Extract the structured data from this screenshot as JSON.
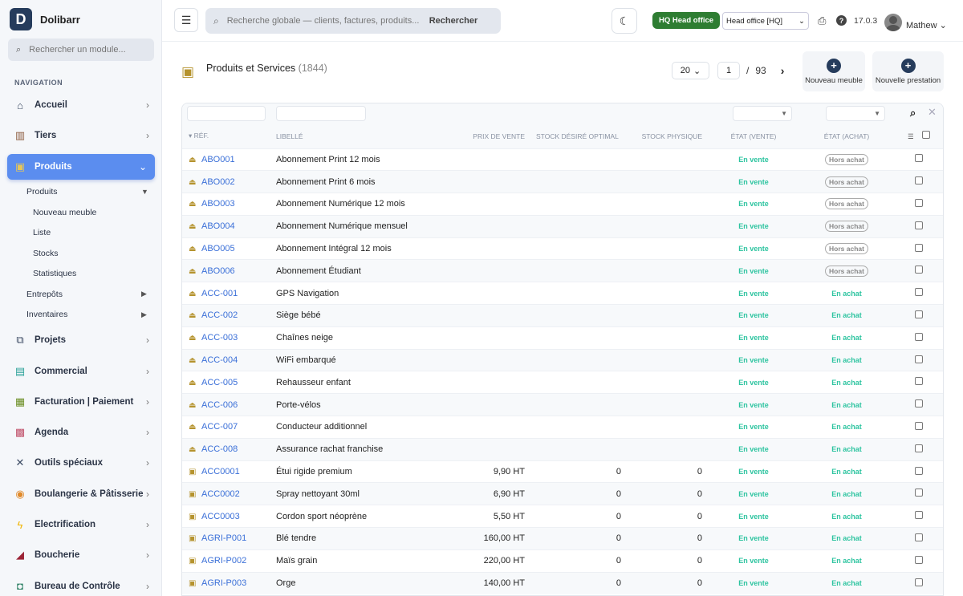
{
  "app": {
    "name": "Dolibarr",
    "logo_letter": "D"
  },
  "sidebar": {
    "search_placeholder": "Rechercher un module...",
    "heading": "NAVIGATION",
    "items": [
      {
        "label": "Accueil",
        "icon": "home-icon"
      },
      {
        "label": "Tiers",
        "icon": "building-icon"
      },
      {
        "label": "Produits",
        "icon": "box-icon",
        "active": true
      },
      {
        "label": "Projets",
        "icon": "sitemap-icon"
      },
      {
        "label": "Commercial",
        "icon": "briefcase-icon"
      },
      {
        "label": "Facturation | Paiement",
        "icon": "invoice-icon"
      },
      {
        "label": "Agenda",
        "icon": "calendar-icon"
      },
      {
        "label": "Outils spéciaux",
        "icon": "tools-icon"
      },
      {
        "label": "Boulangerie & Pâtisserie",
        "icon": "bread-icon"
      },
      {
        "label": "Electrification",
        "icon": "bolt-icon"
      },
      {
        "label": "Boucherie",
        "icon": "meat-icon"
      },
      {
        "label": "Bureau de Contrôle",
        "icon": "shield-icon"
      }
    ],
    "produits_sub": {
      "produits": "Produits",
      "nouveau_meuble": "Nouveau meuble",
      "liste": "Liste",
      "stocks": "Stocks",
      "statistiques": "Statistiques",
      "entrepots": "Entrepôts",
      "inventaires": "Inventaires"
    }
  },
  "topbar": {
    "search_placeholder": "Recherche globale — clients, factures, produits...",
    "search_button": "Rechercher",
    "entity_badge": "HQ Head office",
    "entity_select": "Head office [HQ]",
    "version": "17.0.3",
    "username": "Mathew"
  },
  "page": {
    "title": "Produits et Services",
    "count": "(1844)",
    "limit": "20",
    "current_page": "1",
    "slash": "/",
    "total_pages": "93",
    "actions": {
      "new_furniture": "Nouveau meuble",
      "new_service": "Nouvelle prestation"
    }
  },
  "table": {
    "headers": {
      "ref": "Réf.",
      "label": "Libellé",
      "price": "Prix de vente",
      "stock_desired": "Stock désiré optimal",
      "stock_physical": "Stock physique",
      "state_sale": "État (Vente)",
      "state_purchase": "État (Achat)"
    },
    "rows": [
      {
        "ref": "ABO001",
        "label": "Abonnement Print 12 mois",
        "price": "",
        "stock_desired": "",
        "stock": "",
        "sale": "En vente",
        "purchase": "Hors achat",
        "type": "service"
      },
      {
        "ref": "ABO002",
        "label": "Abonnement Print 6 mois",
        "price": "",
        "stock_desired": "",
        "stock": "",
        "sale": "En vente",
        "purchase": "Hors achat",
        "type": "service"
      },
      {
        "ref": "ABO003",
        "label": "Abonnement Numérique 12 mois",
        "price": "",
        "stock_desired": "",
        "stock": "",
        "sale": "En vente",
        "purchase": "Hors achat",
        "type": "service"
      },
      {
        "ref": "ABO004",
        "label": "Abonnement Numérique mensuel",
        "price": "",
        "stock_desired": "",
        "stock": "",
        "sale": "En vente",
        "purchase": "Hors achat",
        "type": "service"
      },
      {
        "ref": "ABO005",
        "label": "Abonnement Intégral 12 mois",
        "price": "",
        "stock_desired": "",
        "stock": "",
        "sale": "En vente",
        "purchase": "Hors achat",
        "type": "service"
      },
      {
        "ref": "ABO006",
        "label": "Abonnement Étudiant",
        "price": "",
        "stock_desired": "",
        "stock": "",
        "sale": "En vente",
        "purchase": "Hors achat",
        "type": "service"
      },
      {
        "ref": "ACC-001",
        "label": "GPS Navigation",
        "price": "",
        "stock_desired": "",
        "stock": "",
        "sale": "En vente",
        "purchase": "En achat",
        "type": "service"
      },
      {
        "ref": "ACC-002",
        "label": "Siège bébé",
        "price": "",
        "stock_desired": "",
        "stock": "",
        "sale": "En vente",
        "purchase": "En achat",
        "type": "service"
      },
      {
        "ref": "ACC-003",
        "label": "Chaînes neige",
        "price": "",
        "stock_desired": "",
        "stock": "",
        "sale": "En vente",
        "purchase": "En achat",
        "type": "service"
      },
      {
        "ref": "ACC-004",
        "label": "WiFi embarqué",
        "price": "",
        "stock_desired": "",
        "stock": "",
        "sale": "En vente",
        "purchase": "En achat",
        "type": "service"
      },
      {
        "ref": "ACC-005",
        "label": "Rehausseur enfant",
        "price": "",
        "stock_desired": "",
        "stock": "",
        "sale": "En vente",
        "purchase": "En achat",
        "type": "service"
      },
      {
        "ref": "ACC-006",
        "label": "Porte-vélos",
        "price": "",
        "stock_desired": "",
        "stock": "",
        "sale": "En vente",
        "purchase": "En achat",
        "type": "service"
      },
      {
        "ref": "ACC-007",
        "label": "Conducteur additionnel",
        "price": "",
        "stock_desired": "",
        "stock": "",
        "sale": "En vente",
        "purchase": "En achat",
        "type": "service"
      },
      {
        "ref": "ACC-008",
        "label": "Assurance rachat franchise",
        "price": "",
        "stock_desired": "",
        "stock": "",
        "sale": "En vente",
        "purchase": "En achat",
        "type": "service"
      },
      {
        "ref": "ACC0001",
        "label": "Étui rigide premium",
        "price": "9,90 HT",
        "stock_desired": "0",
        "stock": "0",
        "sale": "En vente",
        "purchase": "En achat",
        "type": "product"
      },
      {
        "ref": "ACC0002",
        "label": "Spray nettoyant 30ml",
        "price": "6,90 HT",
        "stock_desired": "0",
        "stock": "0",
        "sale": "En vente",
        "purchase": "En achat",
        "type": "product"
      },
      {
        "ref": "ACC0003",
        "label": "Cordon sport néoprène",
        "price": "5,50 HT",
        "stock_desired": "0",
        "stock": "0",
        "sale": "En vente",
        "purchase": "En achat",
        "type": "product"
      },
      {
        "ref": "AGRI-P001",
        "label": "Blé tendre",
        "price": "160,00 HT",
        "stock_desired": "0",
        "stock": "0",
        "sale": "En vente",
        "purchase": "En achat",
        "type": "product"
      },
      {
        "ref": "AGRI-P002",
        "label": "Maïs grain",
        "price": "220,00 HT",
        "stock_desired": "0",
        "stock": "0",
        "sale": "En vente",
        "purchase": "En achat",
        "type": "product"
      },
      {
        "ref": "AGRI-P003",
        "label": "Orge",
        "price": "140,00 HT",
        "stock_desired": "0",
        "stock": "0",
        "sale": "En vente",
        "purchase": "En achat",
        "type": "product"
      }
    ]
  },
  "colors": {
    "accent": "#5b8def",
    "brand": "#263c5c",
    "badge_green": "#2e7d32",
    "status_teal": "#2ec4a0",
    "link": "#3a6fd8"
  }
}
